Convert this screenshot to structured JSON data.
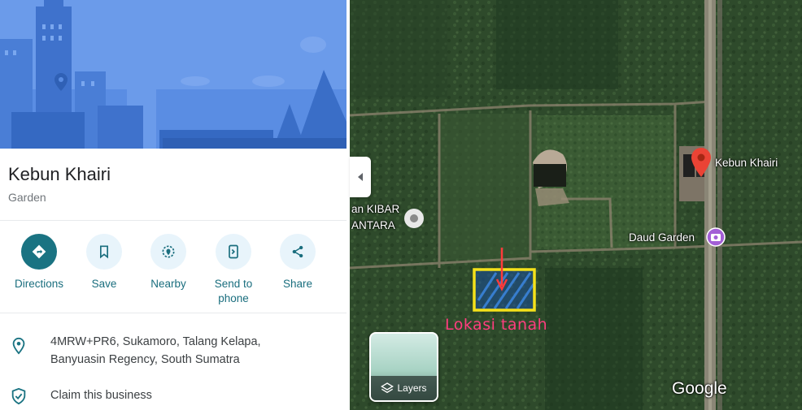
{
  "place": {
    "name": "Kebun Khairi",
    "category": "Garden"
  },
  "actions": [
    {
      "label": "Directions",
      "icon": "directions-icon"
    },
    {
      "label": "Save",
      "icon": "bookmark-icon"
    },
    {
      "label": "Nearby",
      "icon": "nearby-icon"
    },
    {
      "label": "Send to\nphone",
      "icon": "send-to-phone-icon"
    },
    {
      "label": "Share",
      "icon": "share-icon"
    }
  ],
  "info": {
    "address": "4MRW+PR6, Sukamoro, Talang Kelapa,\nBanyuasin Regency, South Sumatra",
    "claim": "Claim this business"
  },
  "map": {
    "labels": {
      "kebun_khairi": "Kebun Khairi",
      "poi_partial_line1": "an KIBAR",
      "poi_partial_line2": "ANTARA",
      "daud_garden": "Daud Garden"
    },
    "annotation_text": "Lokasi tanah",
    "layers_label": "Layers",
    "logo": "Google"
  },
  "colors": {
    "accent": "#1a7382",
    "hero_blue": "#5a8de3",
    "pin_red": "#ea4335",
    "annotation_pink": "#ff3d7f",
    "annotation_yellow": "#f5e11a"
  }
}
